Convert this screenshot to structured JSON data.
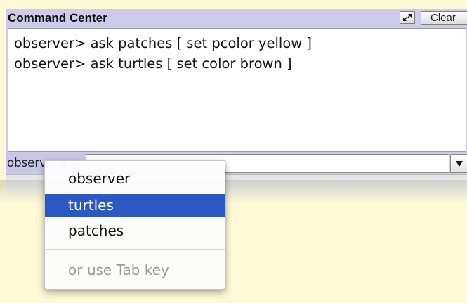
{
  "panel": {
    "title": "Command Center",
    "expand_icon": "expand-arrows-icon",
    "clear_label": "Clear"
  },
  "output": {
    "lines": [
      "observer> ask patches [ set pcolor yellow ]",
      "observer> ask turtles [ set color brown ]"
    ]
  },
  "command_line": {
    "agent_label": "observer>",
    "input_value": "",
    "history_icon": "triangle-down-icon"
  },
  "agent_menu": {
    "items": [
      {
        "label": "observer",
        "selected": false
      },
      {
        "label": "turtles",
        "selected": true
      },
      {
        "label": "patches",
        "selected": false
      }
    ],
    "hint": "or use Tab key"
  },
  "colors": {
    "background": "#fdf9d6",
    "panel": "#cdcbec",
    "selection": "#2c58c4"
  }
}
